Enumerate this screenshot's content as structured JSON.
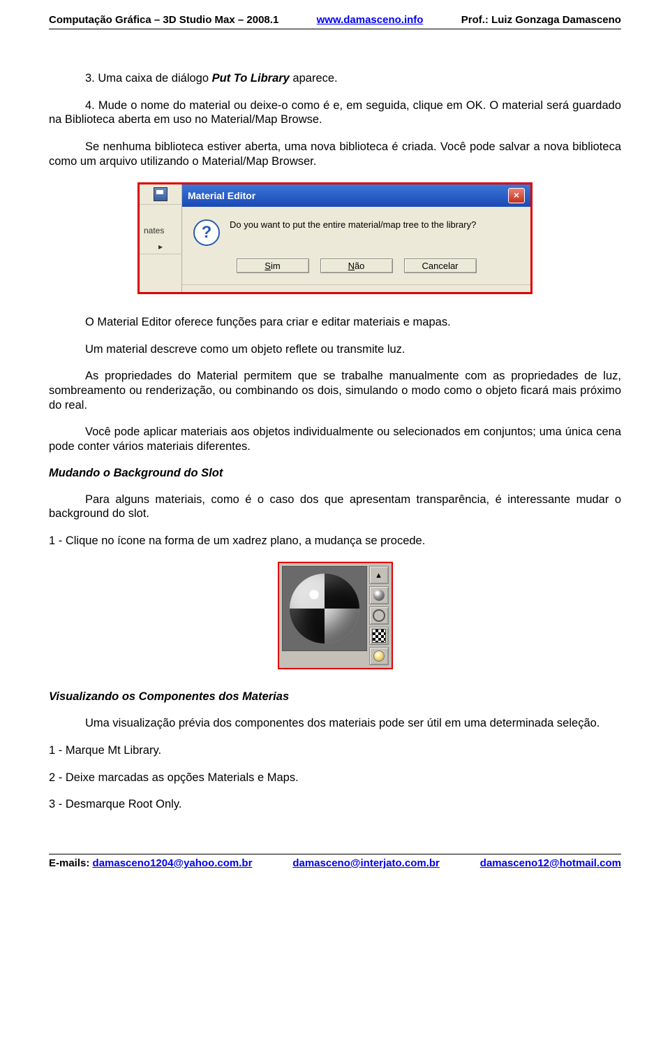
{
  "header": {
    "left": "Computação Gráfica – 3D Studio Max – 2008.1",
    "center_link": "www.damasceno.info",
    "right": "Prof.: Luiz Gonzaga Damasceno"
  },
  "body": {
    "p1a": "3. Uma caixa de diálogo ",
    "p1b": "Put To Library",
    "p1c": " aparece.",
    "p2": "4. Mude o nome do material ou deixe-o como é e, em seguida, clique em OK. O material será guardado na Biblioteca aberta em uso no Material/Map Browse.",
    "p3": "Se nenhuma biblioteca estiver aberta, uma nova biblioteca é criada. Você pode salvar a nova biblioteca como um arquivo utilizando o Material/Map Browser.",
    "dialog": {
      "title": "Material Editor",
      "left_label": "nates",
      "message": "Do you want to put the entire material/map tree to the library?",
      "btn_yes": "Sim",
      "btn_no": "Não",
      "btn_cancel": "Cancelar"
    },
    "p4": "O Material Editor oferece funções para criar e editar materiais e mapas.",
    "p5": "Um material descreve como um objeto reflete ou transmite luz.",
    "p6": "As propriedades do Material permitem que se trabalhe manualmente com as propriedades de luz, sombreamento ou renderização, ou combinando os dois, simulando o modo como o objeto ficará mais próximo do real.",
    "p7": "Você pode  aplicar materiais aos objetos individualmente ou selecionados em conjuntos; uma única cena pode conter vários materiais diferentes.",
    "h1": "Mudando o Background do Slot",
    "p8": "Para alguns materiais, como é o caso dos que apresentam transparência, é interessante mudar o background do slot.",
    "p9": "1 - Clique no ícone na forma de um xadrez plano, a mudança se procede.",
    "h2": "Visualizando os Componentes dos Materias",
    "p10": "Uma visualização prévia dos componentes dos materiais pode ser útil em uma determinada seleção.",
    "p11": "1 - Marque Mt Library.",
    "p12": "2 - Deixe marcadas as opções Materials e Maps.",
    "p13": "3 - Desmarque Root Only."
  },
  "footer": {
    "label": "E-mails: ",
    "email1": "damasceno1204@yahoo.com.br",
    "email2": "damasceno@interjato.com.br",
    "email3": "damasceno12@hotmail.com"
  }
}
